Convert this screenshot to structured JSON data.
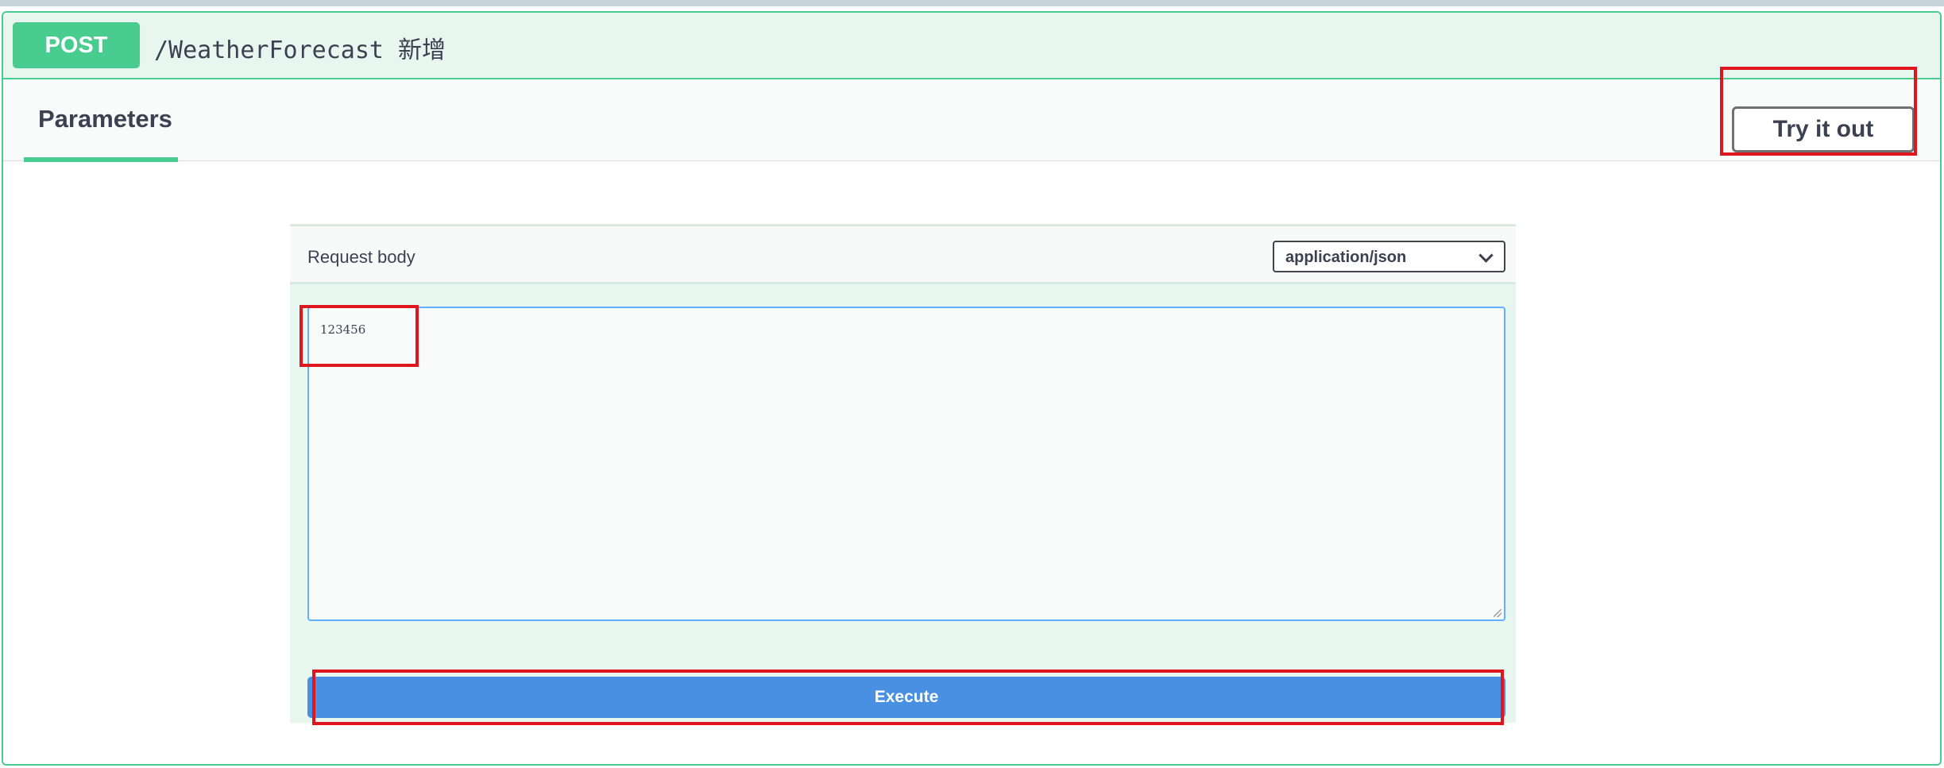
{
  "operation": {
    "method": "POST",
    "path": "/WeatherForecast 新增"
  },
  "tabs": {
    "parameters_label": "Parameters",
    "try_it_out_label": "Try it out"
  },
  "request_body": {
    "label": "Request body",
    "content_type": "application/json",
    "value": "123456"
  },
  "execute_label": "Execute",
  "colors": {
    "post_green": "#49cc90",
    "summary_bg": "#e8f6f0",
    "execute_blue": "#4990e2",
    "highlight_red": "#e0161f"
  }
}
